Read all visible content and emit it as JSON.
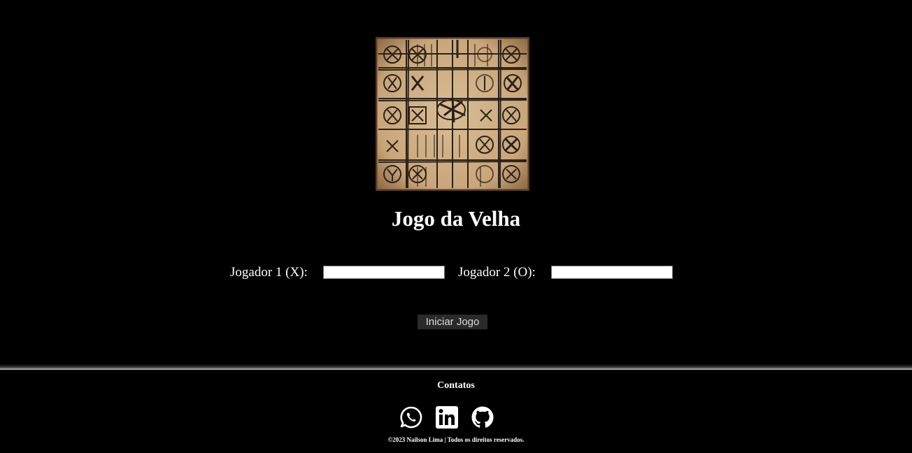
{
  "page": {
    "title": "Jogo da Velha"
  },
  "logo": {
    "icon": "tic-tac-toe-parchment-board"
  },
  "players": {
    "player1_label": "Jogador 1 (X):",
    "player1_value": "",
    "player2_label": "Jogador 2 (O):",
    "player2_value": ""
  },
  "actions": {
    "start_label": "Iniciar Jogo"
  },
  "footer": {
    "contacts_title": "Contatos",
    "social": [
      {
        "name": "whatsapp-icon"
      },
      {
        "name": "linkedin-icon"
      },
      {
        "name": "github-icon"
      }
    ],
    "copyright": "©2023 Nailson Lima | Todos os direitos reservados."
  },
  "colors": {
    "background": "#000000",
    "text": "#ffffff",
    "button_bg": "#2a2a2a",
    "parchment": "#d4b48a"
  }
}
